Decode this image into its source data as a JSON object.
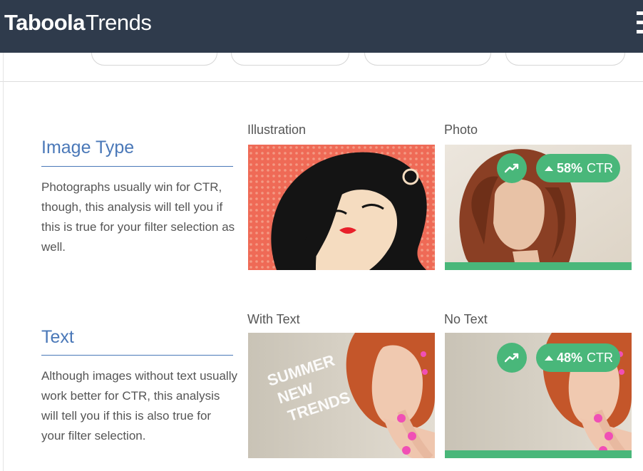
{
  "header": {
    "logo_bold": "Taboola",
    "logo_light": "Trends"
  },
  "sections": {
    "image_type": {
      "title": "Image Type",
      "description": "Photographs usually win for CTR, though, this analysis will tell you if this is true for your filter selection as well.",
      "left_label": "Illustration",
      "right_label": "Photo",
      "ctr": "58%",
      "ctr_suffix": "CTR"
    },
    "text": {
      "title": "Text",
      "description": "Although images without text usually work better for CTR, this analysis will tell you if this is also true for your filter selection.",
      "left_label": "With Text",
      "right_label": "No Text",
      "ctr": "48%",
      "ctr_suffix": "CTR",
      "overlay_text": [
        "SUMMER",
        "NEW",
        "TRENDS"
      ]
    }
  },
  "icons": {
    "trend": "trending-up-icon",
    "ctr_arrow": "triangle-up-icon",
    "menu": "hamburger-menu-icon"
  },
  "colors": {
    "header_bg": "#2f3b4c",
    "accent_blue": "#4a78b8",
    "winner_green": "#49b77a"
  }
}
